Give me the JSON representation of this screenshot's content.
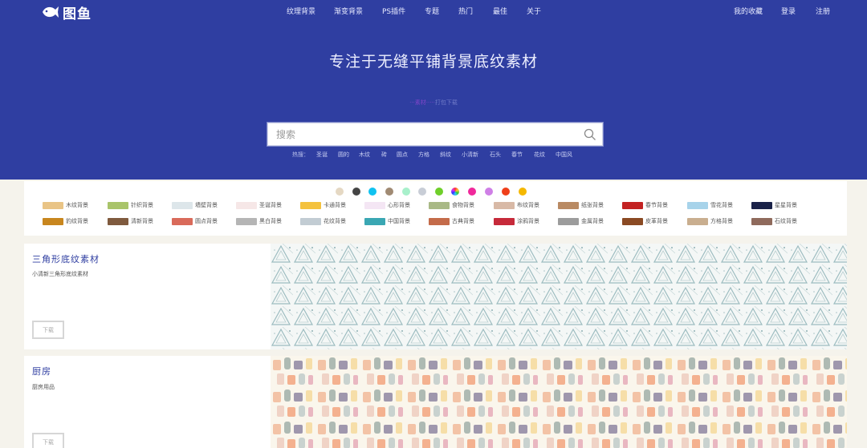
{
  "brand": {
    "logo_text": "图鱼"
  },
  "nav": {
    "items": [
      "纹理背景",
      "渐变背景",
      "PS插件",
      "专题",
      "热门",
      "最佳",
      "关于"
    ],
    "right": [
      "我的收藏",
      "登录",
      "注册"
    ]
  },
  "hero": {
    "slogan": "专注于无缝平铺背景底纹素材",
    "subline_accent": "···素材·····",
    "subline_rest": "打包下载"
  },
  "search": {
    "placeholder": "搜索",
    "hot_label": "热搜：",
    "hot_items": [
      "圣诞",
      "圆的",
      "木纹",
      "砖",
      "圆点",
      "方格",
      "斜纹",
      "小清新",
      "石头",
      "春节",
      "花纹",
      "中国风"
    ]
  },
  "colors": {
    "brand": "#2f3ea1",
    "swatches": [
      "#e5d8c3",
      "#444444",
      "#10c2f0",
      "#a08a73",
      "#a8f0cb",
      "#c8cdd6",
      "#6fcf2a",
      "rainbow",
      "#f0289b",
      "#cf7fe6",
      "#ef3f1a",
      "#f5b800"
    ]
  },
  "categories": {
    "row1": [
      {
        "label": "木纹背景",
        "color": "#e9c486"
      },
      {
        "label": "针织背景",
        "color": "#a9c46a"
      },
      {
        "label": "墙壁背景",
        "color": "#dde6ea"
      },
      {
        "label": "圣诞背景",
        "color": "#f6e7e7"
      },
      {
        "label": "卡通背景",
        "color": "#f4c23e"
      },
      {
        "label": "心形背景",
        "color": "#f4e6f4"
      },
      {
        "label": "食物背景",
        "color": "#a9b986"
      },
      {
        "label": "布纹背景",
        "color": "#d8b9a6"
      },
      {
        "label": "纸张背景",
        "color": "#b98a63"
      },
      {
        "label": "春节背景",
        "color": "#c32222"
      },
      {
        "label": "雪花背景",
        "color": "#a7d3ea"
      },
      {
        "label": "星星背景",
        "color": "#1a2248"
      }
    ],
    "row2": [
      {
        "label": "豹纹背景",
        "color": "#c8861e"
      },
      {
        "label": "清新背景",
        "color": "#7f5a3e"
      },
      {
        "label": "圆点背景",
        "color": "#d96a5a"
      },
      {
        "label": "黑白背景",
        "color": "#b5b5b5"
      },
      {
        "label": "花纹背景",
        "color": "#c2ccd3"
      },
      {
        "label": "中国背景",
        "color": "#3aa7b3"
      },
      {
        "label": "古典背景",
        "color": "#c46b4a"
      },
      {
        "label": "涂鸦背景",
        "color": "#c62a3a"
      },
      {
        "label": "金属背景",
        "color": "#9c9c9c"
      },
      {
        "label": "皮革背景",
        "color": "#8a4a23"
      },
      {
        "label": "方格背景",
        "color": "#c9ae8f"
      },
      {
        "label": "石纹背景",
        "color": "#8f6a5c"
      }
    ]
  },
  "cards": [
    {
      "title": "三角形底纹素材",
      "desc": "小清新三角形底纹素材",
      "button": "下载"
    },
    {
      "title": "厨房",
      "desc": "厨房用品",
      "button": "下载"
    }
  ]
}
